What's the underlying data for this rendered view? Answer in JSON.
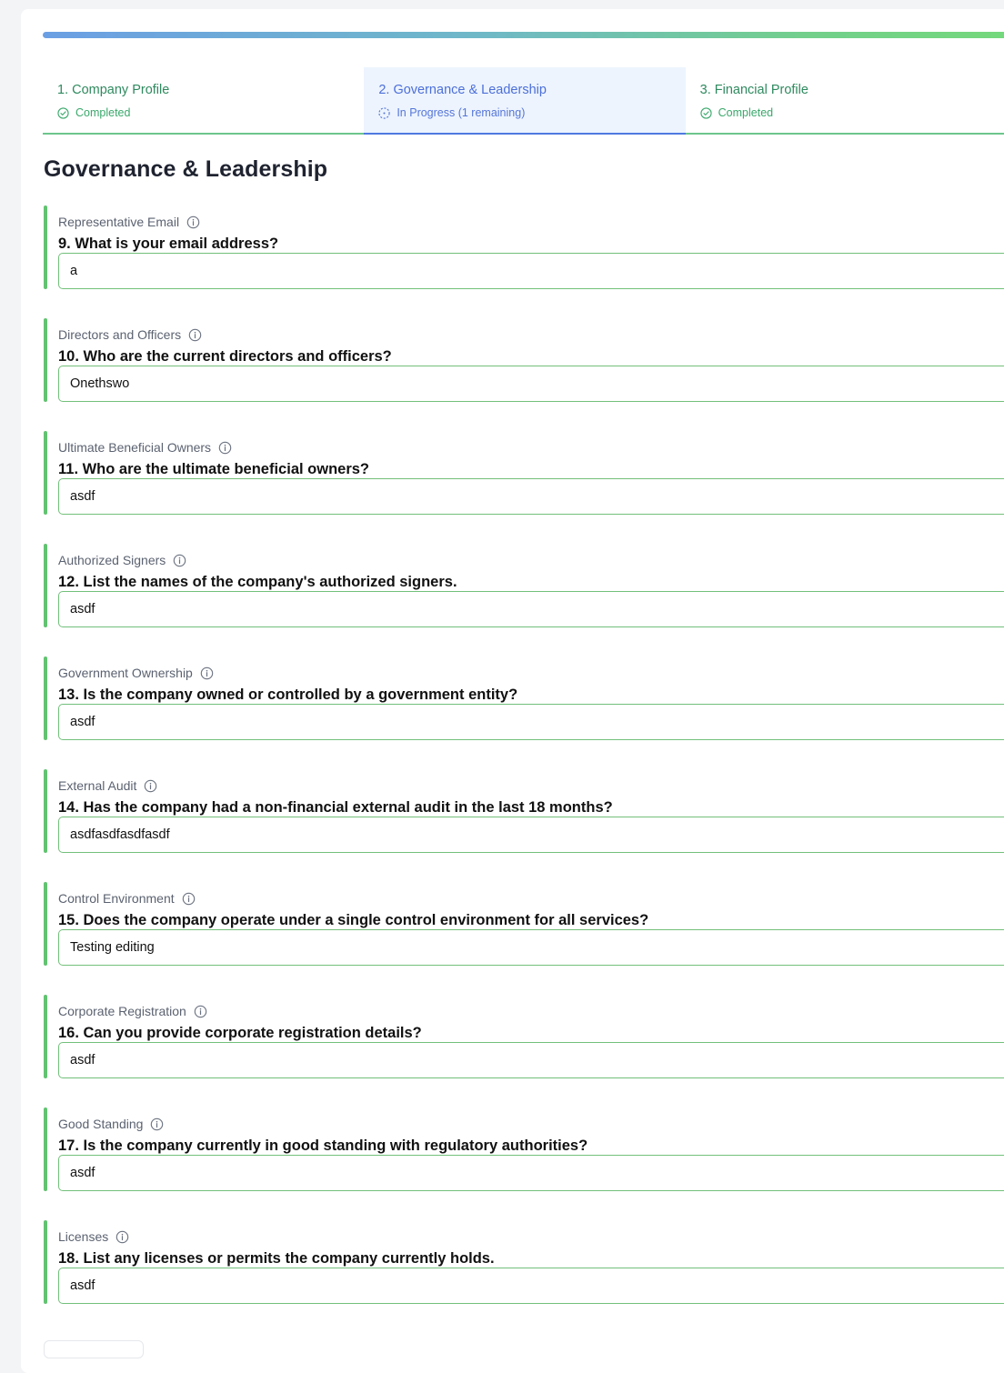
{
  "colors": {
    "accent_green": "#62c371",
    "accent_blue": "#4c6fd9",
    "completed_green": "#3aa86b"
  },
  "steps": [
    {
      "title": "1. Company Profile",
      "status": "Completed",
      "state": "completed",
      "icon": "check-circle-icon"
    },
    {
      "title": "2. Governance & Leadership",
      "status": "In Progress (1 remaining)",
      "state": "in-progress",
      "icon": "dashed-circle-icon"
    },
    {
      "title": "3. Financial Profile",
      "status": "Completed",
      "state": "completed",
      "icon": "check-circle-icon"
    }
  ],
  "section": {
    "title": "Governance & Leadership"
  },
  "questions": [
    {
      "label": "Representative Email",
      "text": "9. What is your email address?",
      "value": "a"
    },
    {
      "label": "Directors and Officers",
      "text": "10. Who are the current directors and officers?",
      "value": "Onethswo"
    },
    {
      "label": "Ultimate Beneficial Owners",
      "text": "11. Who are the ultimate beneficial owners?",
      "value": "asdf"
    },
    {
      "label": "Authorized Signers",
      "text": "12. List the names of the company's authorized signers.",
      "value": "asdf"
    },
    {
      "label": "Government Ownership",
      "text": "13. Is the company owned or controlled by a government entity?",
      "value": "asdf"
    },
    {
      "label": "External Audit",
      "text": "14. Has the company had a non-financial external audit in the last 18 months?",
      "value": "asdfasdfasdfasdf"
    },
    {
      "label": "Control Environment",
      "text": "15. Does the company operate under a single control environment for all services?",
      "value": "Testing editing"
    },
    {
      "label": "Corporate Registration",
      "text": "16. Can you provide corporate registration details?",
      "value": "asdf"
    },
    {
      "label": "Good Standing",
      "text": "17. Is the company currently in good standing with regulatory authorities?",
      "value": "asdf"
    },
    {
      "label": "Licenses",
      "text": "18. List any licenses or permits the company currently holds.",
      "value": "asdf"
    }
  ]
}
